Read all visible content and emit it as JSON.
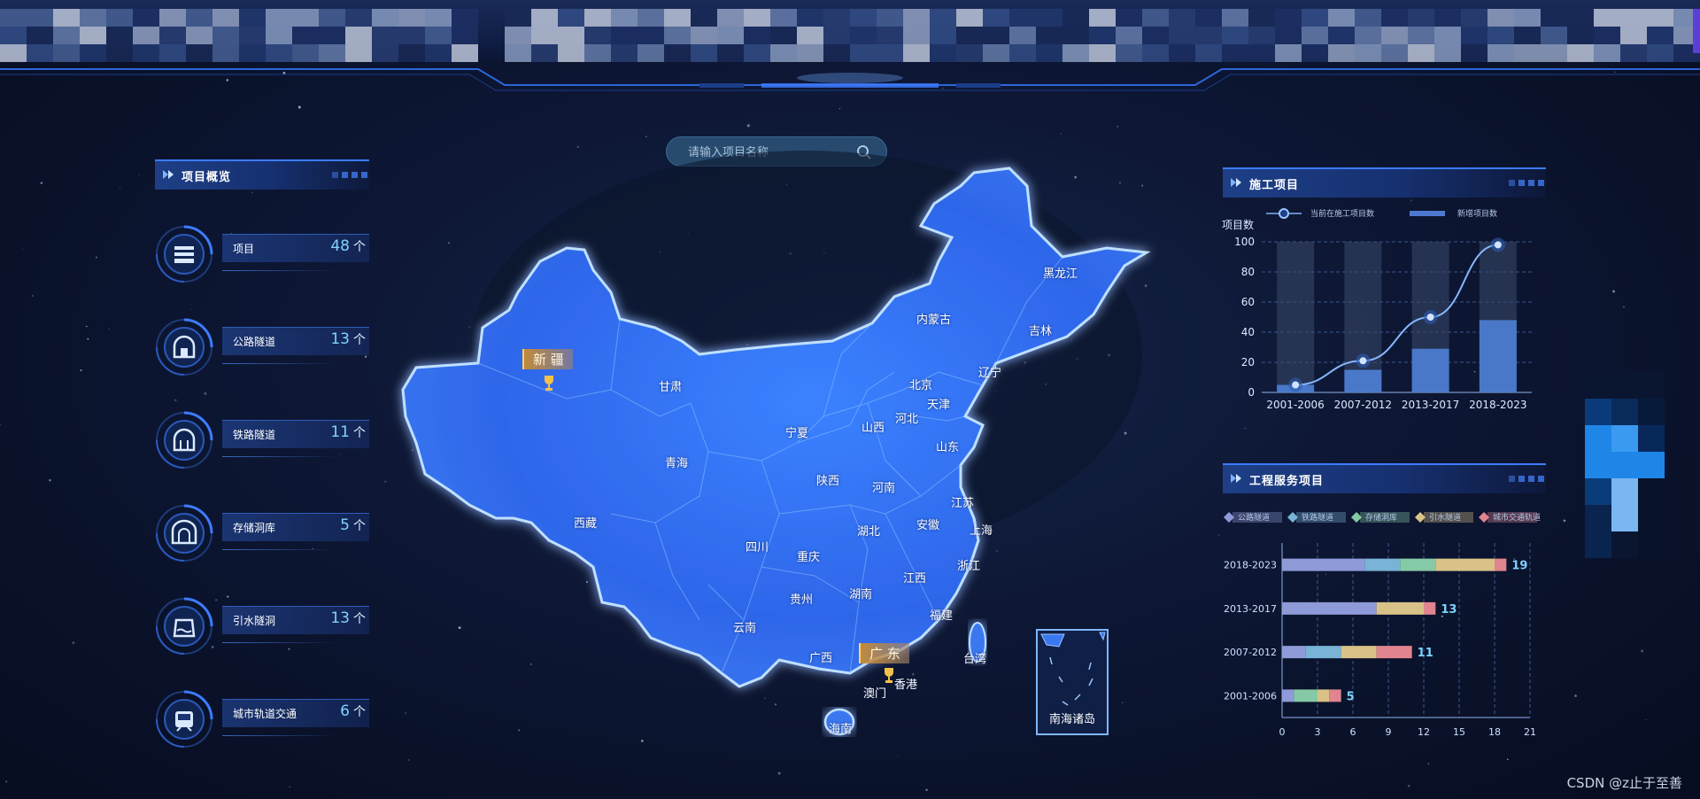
{
  "search": {
    "placeholder": "请输入项目名称"
  },
  "overview": {
    "title": "项目概览",
    "items": [
      {
        "label": "项目",
        "value": "48",
        "unit": "个",
        "icon": "stack-icon"
      },
      {
        "label": "公路隧道",
        "value": "13",
        "unit": "个",
        "icon": "tunnel-icon"
      },
      {
        "label": "铁路隧道",
        "value": "11",
        "unit": "个",
        "icon": "rail-tunnel-icon"
      },
      {
        "label": "存储洞库",
        "value": "5",
        "unit": "个",
        "icon": "storage-icon"
      },
      {
        "label": "引水隧洞",
        "value": "13",
        "unit": "个",
        "icon": "water-icon"
      },
      {
        "label": "城市轨道交通",
        "value": "6",
        "unit": "个",
        "icon": "metro-icon"
      }
    ]
  },
  "map": {
    "provinces": [
      "新疆",
      "甘肃",
      "青海",
      "西藏",
      "宁夏",
      "陕西",
      "四川",
      "重庆",
      "贵州",
      "云南",
      "广西",
      "内蒙古",
      "黑龙江",
      "吉林",
      "辽宁",
      "北京",
      "天津",
      "河北",
      "山西",
      "山东",
      "河南",
      "湖北",
      "安徽",
      "江苏",
      "上海",
      "浙江",
      "湖南",
      "江西",
      "福建",
      "台湾",
      "广东",
      "香港",
      "澳门",
      "海南"
    ],
    "highlighted": [
      "新 疆",
      "广 东"
    ],
    "south_sea_label": "南海诸岛"
  },
  "construction": {
    "title": "施工项目",
    "legend_line": "当前在施工项目数",
    "legend_bar": "新增项目数",
    "ylabel": "项目数"
  },
  "service": {
    "title": "工程服务项目",
    "legend": [
      "公路隧道",
      "铁路隧道",
      "存储洞库",
      "引水隧道",
      "城市交通轨道"
    ]
  },
  "chart_data": [
    {
      "type": "bar",
      "title": "施工项目",
      "ylabel": "项目数",
      "categories": [
        "2001-2006",
        "2007-2012",
        "2013-2017",
        "2018-2023"
      ],
      "ylim": [
        0,
        100
      ],
      "yticks": [
        0,
        20,
        40,
        60,
        80,
        100
      ],
      "series": [
        {
          "name": "新增项目数",
          "kind": "bar",
          "values": [
            5,
            15,
            29,
            48
          ]
        },
        {
          "name": "当前在施工项目数",
          "kind": "line",
          "values": [
            5,
            21,
            50,
            98
          ]
        }
      ],
      "grid": true,
      "legend": "top"
    },
    {
      "type": "bar",
      "orientation": "horizontal",
      "stacked": true,
      "title": "工程服务项目",
      "categories": [
        "2018-2023",
        "2013-2017",
        "2007-2012",
        "2001-2006"
      ],
      "xlim": [
        0,
        21
      ],
      "xticks": [
        0,
        3,
        6,
        9,
        12,
        15,
        18,
        21
      ],
      "series": [
        {
          "name": "公路隧道",
          "values": [
            7,
            8,
            2,
            1
          ],
          "color": "#8e9bd8"
        },
        {
          "name": "铁路隧道",
          "values": [
            3,
            0,
            3,
            0
          ],
          "color": "#79b3d6"
        },
        {
          "name": "存储洞库",
          "values": [
            3,
            0,
            0,
            2
          ],
          "color": "#86c9a6"
        },
        {
          "name": "引水隧道",
          "values": [
            5,
            4,
            3,
            1
          ],
          "color": "#d9c287"
        },
        {
          "name": "城市交通轨道",
          "values": [
            1,
            1,
            3,
            1
          ],
          "color": "#e0848f"
        }
      ],
      "totals": [
        19,
        13,
        11,
        5
      ],
      "legend": "top"
    }
  ],
  "watermark": "CSDN @z止于至善",
  "colors": {
    "accent": "#3c7cff",
    "value": "#7fd3ff",
    "map": "#2f6df0"
  }
}
